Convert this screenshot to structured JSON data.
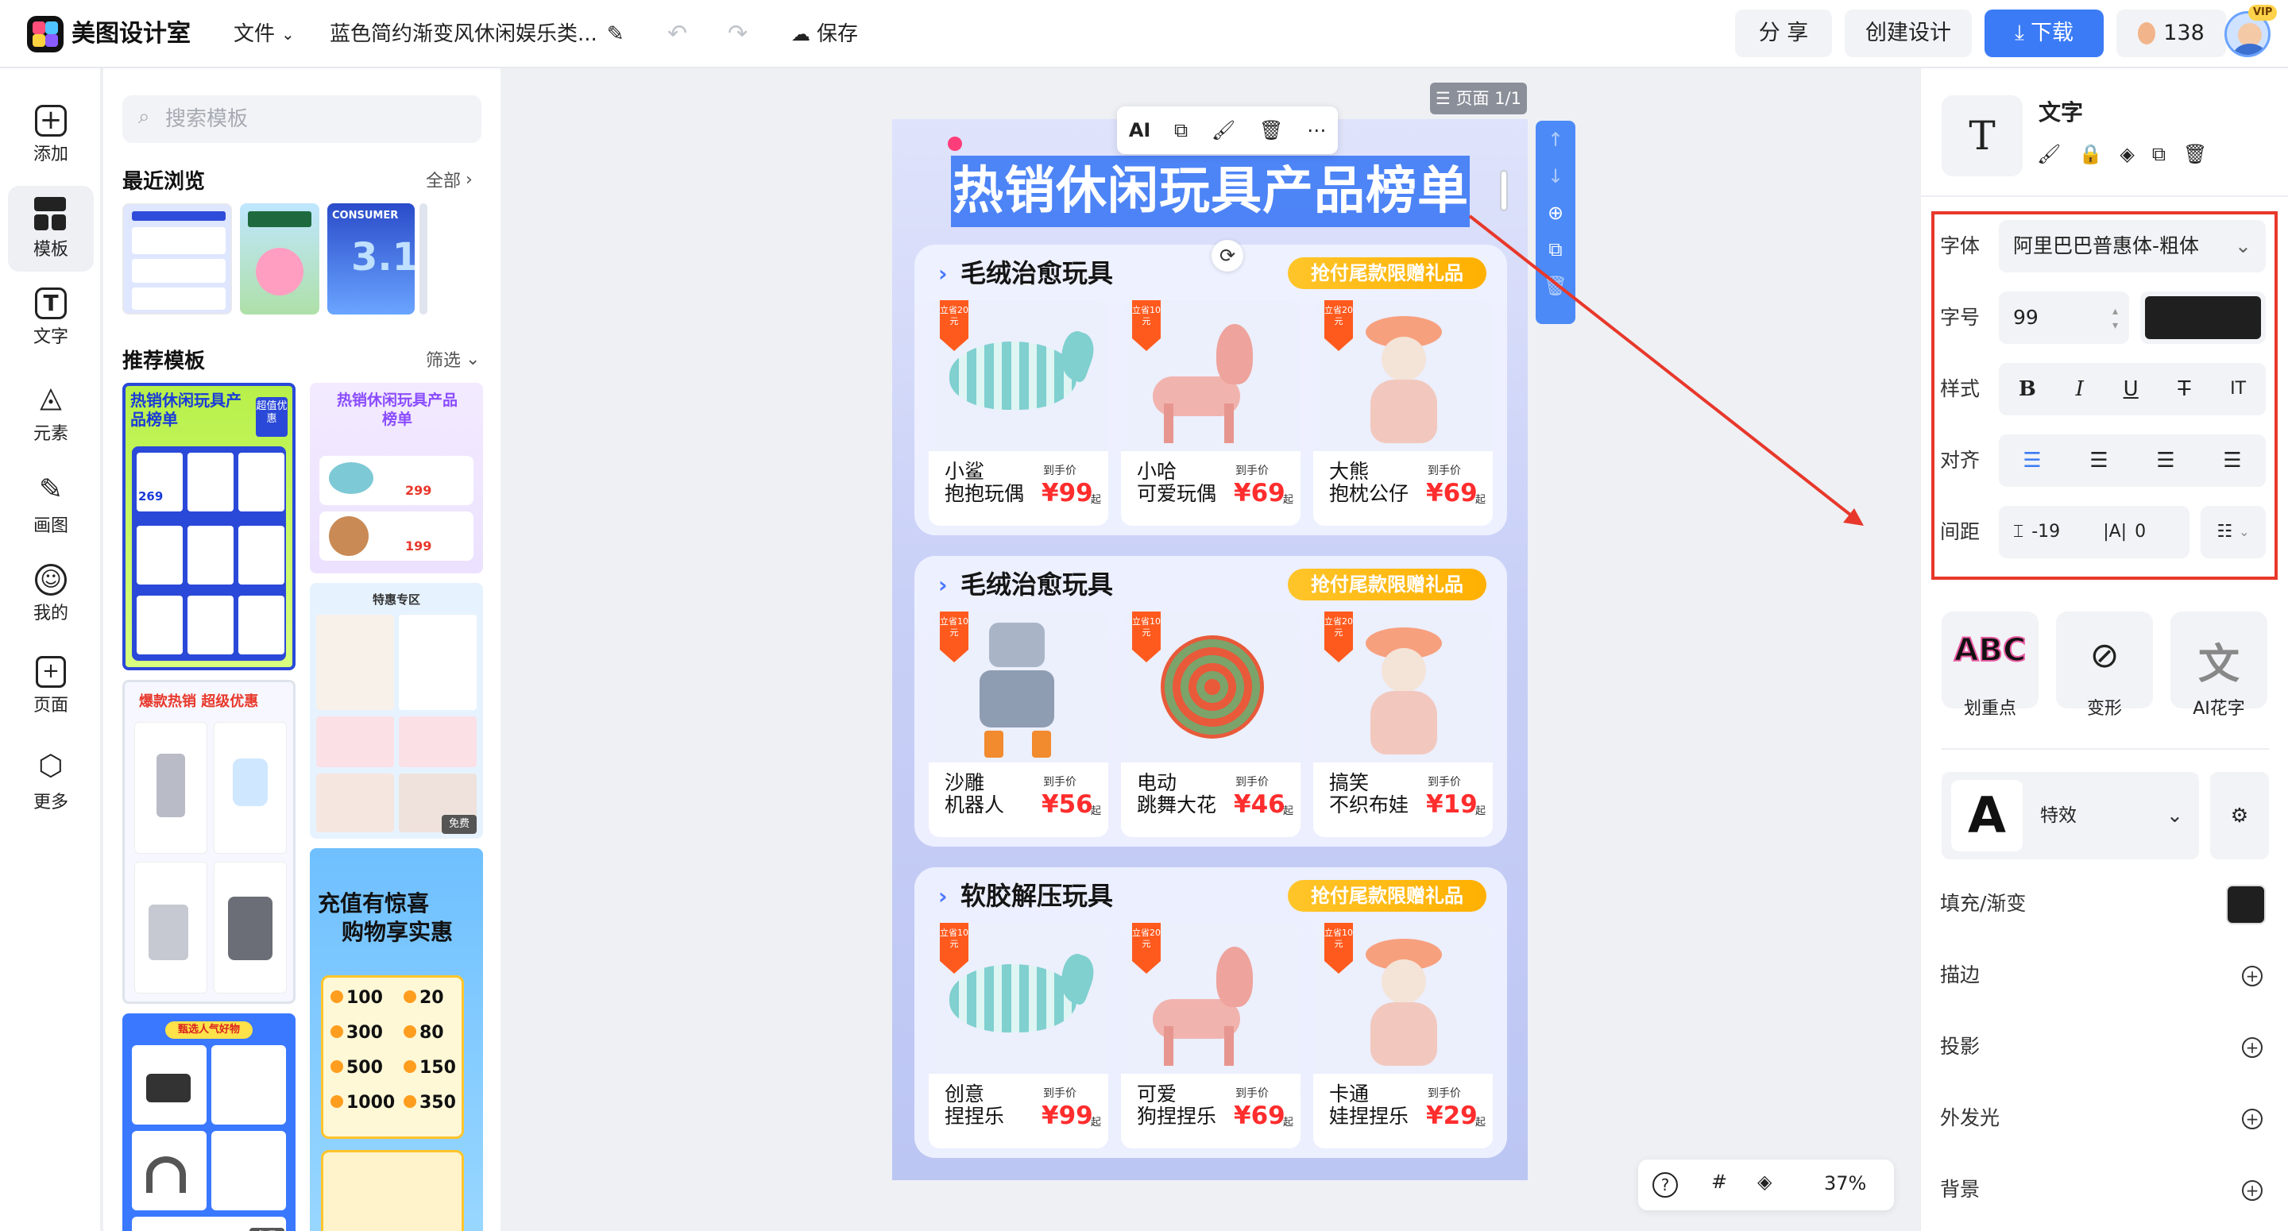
{
  "app": {
    "name": "美图设计室",
    "vip_badge": "VIP"
  },
  "topbar": {
    "file_menu": "文件",
    "doc_title": "蓝色简约渐变风休闲娱乐类...",
    "save": "保存",
    "share": "分 享",
    "create_design": "创建设计",
    "download": "下载",
    "credits": "138"
  },
  "rail": {
    "items": [
      {
        "label": "添加",
        "icon": "add-icon"
      },
      {
        "label": "模板",
        "icon": "template-icon"
      },
      {
        "label": "文字",
        "icon": "text-icon"
      },
      {
        "label": "元素",
        "icon": "elements-icon"
      },
      {
        "label": "画图",
        "icon": "draw-icon"
      },
      {
        "label": "我的",
        "icon": "user-icon"
      },
      {
        "label": "页面",
        "icon": "page-icon"
      },
      {
        "label": "更多",
        "icon": "more-icon"
      }
    ]
  },
  "panel": {
    "search_placeholder": "搜索模板",
    "recent_title": "最近浏览",
    "recent_all": "全部",
    "recommend_title": "推荐模板",
    "filter": "筛选",
    "thumb_texts": {
      "t1_title": "热销休闲玩具产品榜单",
      "t1_badge": "超值优惠",
      "t1_price": "269",
      "t2_title": "热销休闲玩具产品榜单",
      "t2_price1": "299",
      "t2_price2": "199",
      "t3_title": "特惠专区",
      "t3_free": "免费",
      "t4_title": "爆款热销 超级优惠",
      "t5_title": "甄选人气好物",
      "t5_free": "免费",
      "t6_title1": "充值有惊喜",
      "t6_title2": "购物享实惠",
      "t6_rows": [
        [
          "100",
          "20"
        ],
        [
          "300",
          "80"
        ],
        [
          "500",
          "150"
        ],
        [
          "1000",
          "350"
        ]
      ],
      "r2_text": "CONSUMER"
    }
  },
  "canvas": {
    "page_badge": "页面 1/1",
    "float_toolbar_ai": "AI",
    "poster_title": "热销休闲玩具产品榜单",
    "zoom": "37%",
    "sections": [
      {
        "name": "毛绒治愈玩具",
        "tag": "抢付尾款限赠礼品",
        "products": [
          {
            "name1": "小鲨",
            "name2": "抱抱玩偶",
            "price": "¥99",
            "ribbon": "立省20元",
            "img": "shark"
          },
          {
            "name1": "小哈",
            "name2": "可爱玩偶",
            "price": "¥69",
            "ribbon": "立省10元",
            "img": "dog"
          },
          {
            "name1": "大熊",
            "name2": "抱枕公仔",
            "price": "¥69",
            "ribbon": "立省20元",
            "img": "rabbit"
          }
        ]
      },
      {
        "name": "毛绒治愈玩具",
        "tag": "抢付尾款限赠礼品",
        "products": [
          {
            "name1": "沙雕",
            "name2": "机器人",
            "price": "¥56",
            "ribbon": "立省10元",
            "img": "robot"
          },
          {
            "name1": "电动",
            "name2": "跳舞大花",
            "price": "¥46",
            "ribbon": "立省10元",
            "img": "yoyo"
          },
          {
            "name1": "搞笑",
            "name2": "不织布娃",
            "price": "¥19",
            "ribbon": "立省20元",
            "img": "rabbit"
          }
        ]
      },
      {
        "name": "软胶解压玩具",
        "tag": "抢付尾款限赠礼品",
        "products": [
          {
            "name1": "创意",
            "name2": "捏捏乐",
            "price": "¥99",
            "ribbon": "立省10元",
            "img": "shark"
          },
          {
            "name1": "可爱",
            "name2": "狗捏捏乐",
            "price": "¥69",
            "ribbon": "立省20元",
            "img": "dog"
          },
          {
            "name1": "卡通",
            "name2": "娃捏捏乐",
            "price": "¥29",
            "ribbon": "立省10元",
            "img": "rabbit"
          }
        ]
      }
    ],
    "price_label": "到手价",
    "price_suffix": "起"
  },
  "rpanel": {
    "element_type": "文字",
    "font_label": "字体",
    "font_value": "阿里巴巴普惠体-粗体",
    "size_label": "字号",
    "size_value": "99",
    "text_color": "#1f1f1f",
    "style_label": "样式",
    "style_buttons": [
      "B",
      "I",
      "U",
      "T",
      "IT"
    ],
    "align_label": "对齐",
    "spacing_label": "间距",
    "letter_spacing": "-19",
    "line_spacing": "0",
    "fx_buttons": [
      {
        "icon_text": "ABC",
        "label": "划重点"
      },
      {
        "icon_text": "⊘",
        "label": "变形"
      },
      {
        "icon_text": "文",
        "label": "AI花字"
      }
    ],
    "effect_label": "特效",
    "fill_label": "填充/渐变",
    "stroke_label": "描边",
    "shadow_label": "投影",
    "glow_label": "外发光",
    "background_label": "背景",
    "accent": "#e8382b",
    "brand": "#3b7bf6"
  }
}
